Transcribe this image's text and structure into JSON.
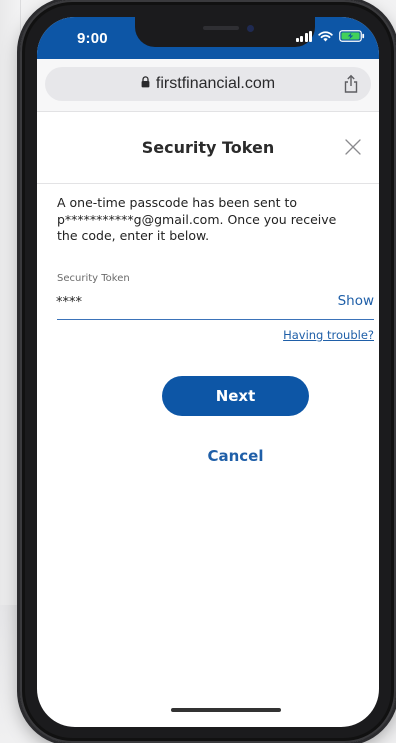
{
  "status_bar": {
    "time": "9:00",
    "background": "#0d56a6"
  },
  "browser": {
    "url": "firstfinancial.com",
    "lock_icon": "lock-icon",
    "share_icon": "share-icon"
  },
  "page": {
    "title": "Security Token",
    "close_icon": "close-icon",
    "instructions": "A one-time passcode has been sent to p***********g@gmail.com. Once you receive the code, enter it below.",
    "token_field": {
      "label": "Security Token",
      "value": "****"
    },
    "show_label": "Show",
    "trouble_label": "Having trouble?",
    "next_label": "Next",
    "cancel_label": "Cancel"
  },
  "colors": {
    "brand_blue": "#0d56a6",
    "link_blue": "#1f5fa8"
  }
}
